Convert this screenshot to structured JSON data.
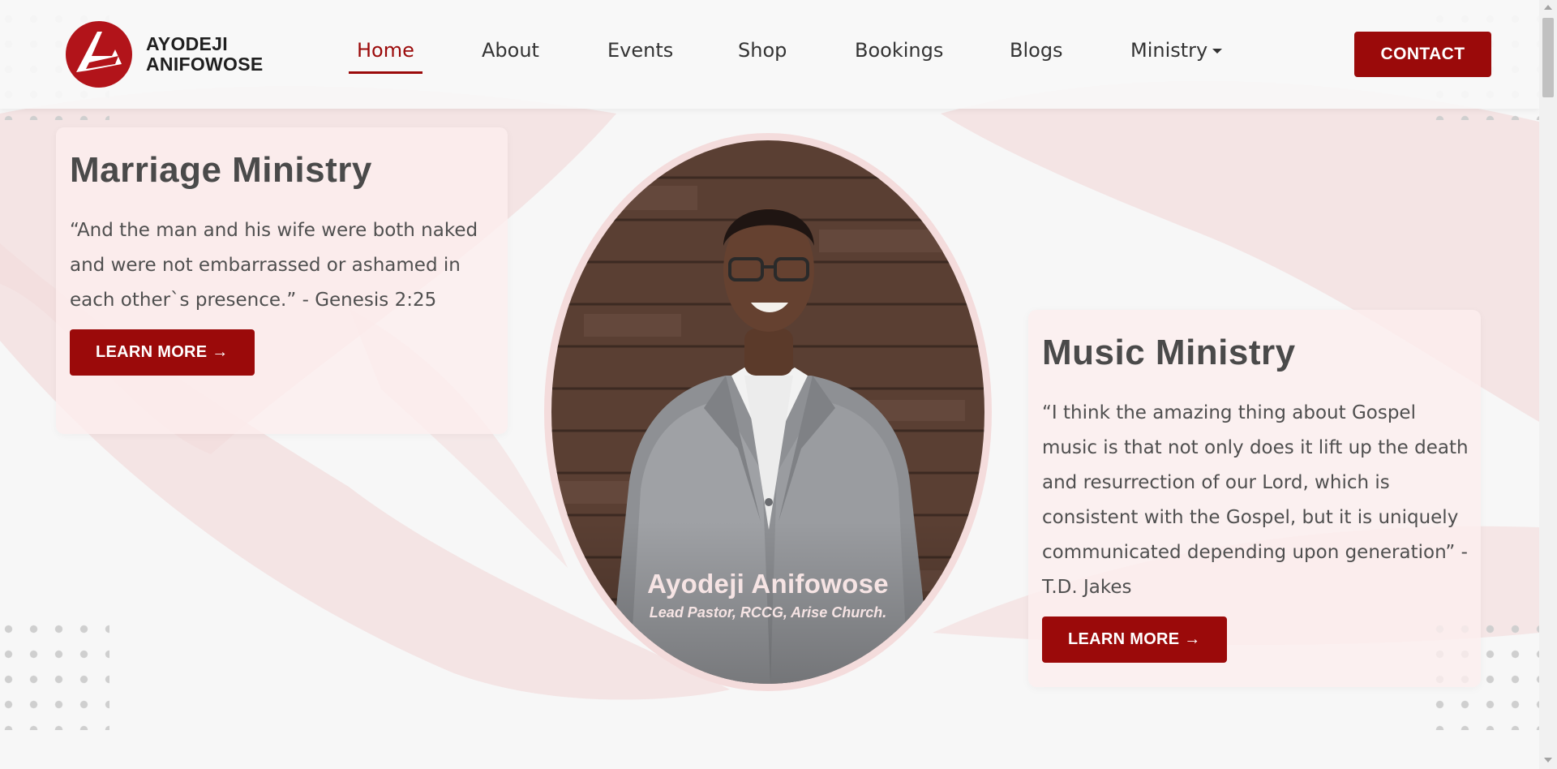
{
  "brand": {
    "name_line1": "AYODEJI",
    "name_line2": "ANIFOWOSE",
    "accent_color": "#9b0a0a"
  },
  "nav": {
    "items": [
      {
        "label": "Home",
        "active": true
      },
      {
        "label": "About",
        "active": false
      },
      {
        "label": "Events",
        "active": false
      },
      {
        "label": "Shop",
        "active": false
      },
      {
        "label": "Bookings",
        "active": false
      },
      {
        "label": "Blogs",
        "active": false
      },
      {
        "label": "Ministry",
        "active": false,
        "dropdown": true
      }
    ],
    "contact_label": "CONTACT"
  },
  "hero": {
    "pastor_name": "Ayodeji Anifowose",
    "pastor_role": "Lead Pastor, RCCG, Arise Church."
  },
  "cards": {
    "marriage": {
      "title": "Marriage Ministry",
      "quote": "“And the man and his wife were both naked and were not embarrassed or ashamed in each other`s presence.” - Genesis 2:25",
      "button": "LEARN MORE →"
    },
    "music": {
      "title": "Music Ministry",
      "quote": "“I think the amazing thing about Gospel music is that not only does it lift up the death and resurrection of our Lord, which is consistent with the Gospel, but it is uniquely communicated depending upon generation” - T.D. Jakes",
      "button": "LEARN MORE →"
    }
  },
  "icons": {
    "logo": "brand-logo-icon",
    "dropdown": "caret-down-icon"
  }
}
